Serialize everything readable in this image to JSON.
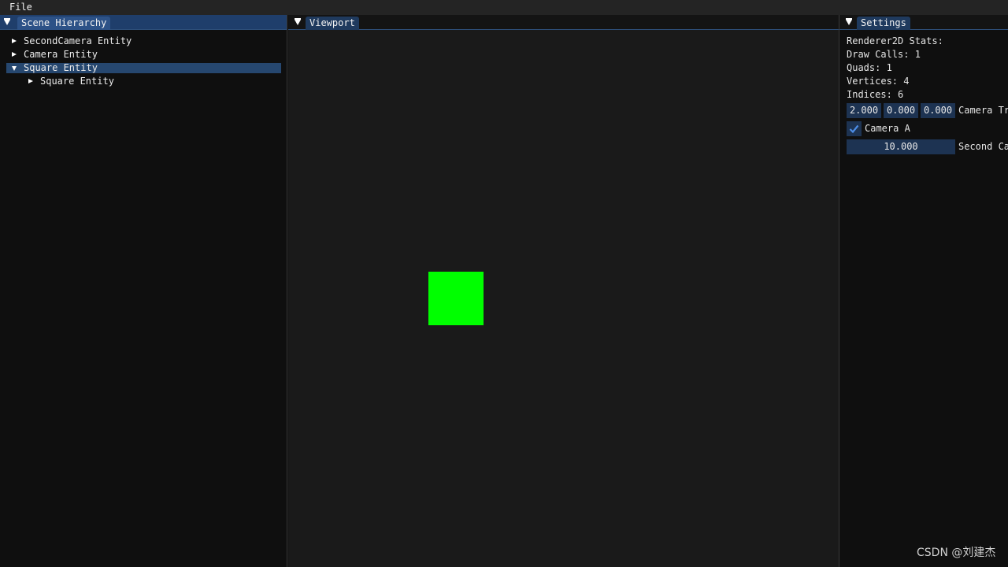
{
  "menubar": {
    "file_label": "File"
  },
  "scene_hierarchy": {
    "title": "Scene Hierarchy",
    "items": [
      {
        "label": "SecondCamera Entity",
        "expanded": false,
        "selected": false
      },
      {
        "label": "Camera Entity",
        "expanded": false,
        "selected": false
      },
      {
        "label": "Square Entity",
        "expanded": true,
        "selected": true
      },
      {
        "label": "Square Entity",
        "expanded": false,
        "selected": false
      }
    ]
  },
  "viewport": {
    "title": "Viewport",
    "square_color": "#00ff00"
  },
  "settings": {
    "title": "Settings",
    "stats_header": "Renderer2D Stats:",
    "draw_calls": "Draw Calls: 1",
    "quads": "Quads: 1",
    "vertices": "Vertices: 4",
    "indices": "Indices: 6",
    "camera_transform": {
      "x": "2.000",
      "y": "0.000",
      "z": "0.000",
      "label": "Camera Tr"
    },
    "camera_a": {
      "checked": true,
      "label": "Camera A"
    },
    "second_camera": {
      "value": "10.000",
      "label": "Second Ca"
    }
  },
  "watermark": "CSDN @刘建杰"
}
